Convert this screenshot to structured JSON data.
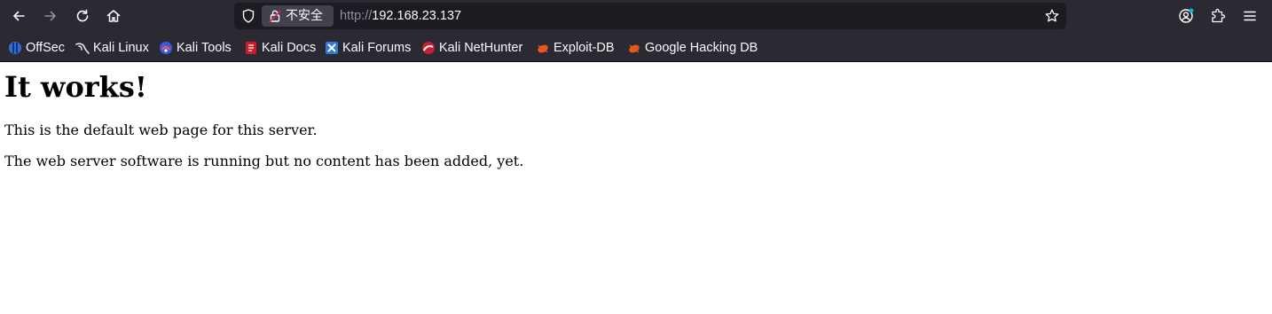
{
  "toolbar": {
    "back_icon": "arrow-left-icon",
    "forward_icon": "arrow-right-icon",
    "reload_icon": "reload-icon",
    "home_icon": "home-icon"
  },
  "urlbar": {
    "security_label": "不安全",
    "url_scheme": "http://",
    "url_host": "192.168.23.137"
  },
  "bookmarks": [
    {
      "label": "OffSec"
    },
    {
      "label": "Kali Linux"
    },
    {
      "label": "Kali Tools"
    },
    {
      "label": "Kali Docs"
    },
    {
      "label": "Kali Forums"
    },
    {
      "label": "Kali NetHunter"
    },
    {
      "label": "Exploit-DB"
    },
    {
      "label": "Google Hacking DB"
    }
  ],
  "page": {
    "heading": "It works!",
    "paragraph1": "This is the default web page for this server.",
    "paragraph2": "The web server software is running but no content has been added, yet."
  },
  "colors": {
    "toolbar_bg": "#2b2a33",
    "urlbar_bg": "#1c1b22",
    "text_light": "#fbfbfe",
    "text_dim": "#8f8f9d",
    "insecure_red": "#e22850"
  }
}
